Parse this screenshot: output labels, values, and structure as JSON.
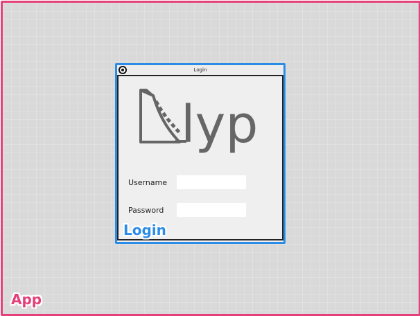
{
  "app": {
    "label": "App",
    "accent_color": "#e5407a"
  },
  "login_window": {
    "title": "Login",
    "accent_color": "#2b8ce8",
    "logo": {
      "icon": "lyp-logo-icon",
      "text": "lyp"
    },
    "username": {
      "label": "Username",
      "value": "",
      "placeholder": ""
    },
    "password": {
      "label": "Password",
      "value": "",
      "placeholder": ""
    },
    "annotation_label": "Login"
  }
}
